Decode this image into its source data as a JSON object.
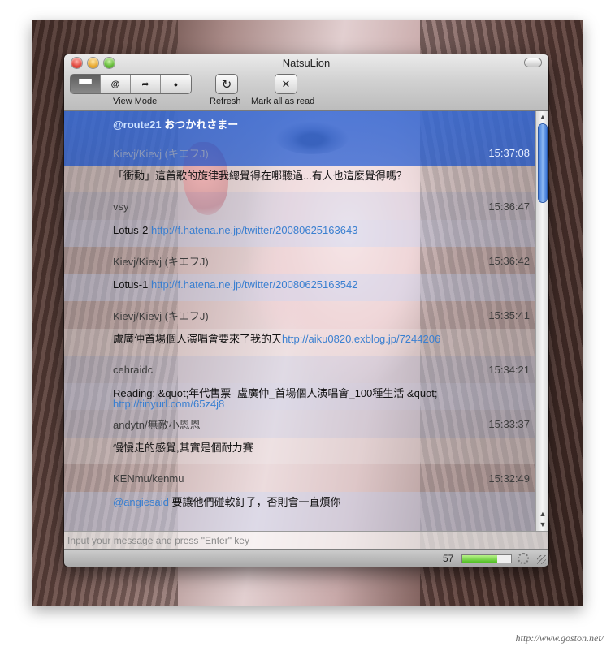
{
  "window": {
    "title": "NatsuLion"
  },
  "toolbar": {
    "view_mode_label": "View Mode",
    "view_mode_buttons": [
      {
        "icon": "people-icon",
        "glyph": "▀▀"
      },
      {
        "icon": "at-icon",
        "glyph": "@"
      },
      {
        "icon": "forward-icon",
        "glyph": "➦"
      },
      {
        "icon": "dot-icon",
        "glyph": "●"
      }
    ],
    "refresh_label": "Refresh",
    "refresh_glyph": "↻",
    "mark_read_label": "Mark all as read",
    "mark_read_glyph": "✕"
  },
  "timeline": {
    "selected_message": {
      "mention": "@route21",
      "text": " おつかれさまー"
    },
    "entries": [
      {
        "author": "Kievj/Kievj (キエフJ)",
        "time": "15:37:08",
        "prefix": "",
        "text": "「衝動」這首歌的旋律我總覺得在哪聽過...有人也這麼覺得嗎？",
        "link": ""
      },
      {
        "author": "vsy",
        "time": "15:36:47",
        "prefix": "",
        "text": "Lotus-2 ",
        "link": "http://f.hatena.ne.jp/twitter/20080625163643"
      },
      {
        "author": "Kievj/Kievj (キエフJ)",
        "time": "15:36:42",
        "prefix": "",
        "text": "Lotus-1 ",
        "link": "http://f.hatena.ne.jp/twitter/20080625163542"
      },
      {
        "author": "Kievj/Kievj (キエフJ)",
        "time": "15:35:41",
        "prefix": "",
        "text": "盧廣仲首場個人演唱會要來了我的天",
        "link": "http://aiku0820.exblog.jp/7244206"
      },
      {
        "author": "cehraidc",
        "time": "15:34:21",
        "prefix": "",
        "text": "Reading: &quot;年代售票- 盧廣仲_首場個人演唱會_100種生活 &quot;  ",
        "link": "http://tinyurl.com/65z4j8"
      },
      {
        "author": "andytn/無敵小恩恩",
        "time": "15:33:37",
        "prefix": "",
        "text": "慢慢走的感覺,其實是個耐力賽",
        "link": ""
      },
      {
        "author": "KENmu/kenmu",
        "time": "15:32:49",
        "prefix": "@angiesaid",
        "text": " 要讓他們碰軟釘子，否則會一直煩你",
        "link": ""
      }
    ]
  },
  "input": {
    "placeholder": "Input your message and press \"Enter\" key",
    "value": ""
  },
  "status": {
    "unread_count": "57",
    "meter_fraction": 0.72
  },
  "watermark": "http://www.goston.net/",
  "colors": {
    "selection": "#3c6ed7",
    "link": "#3a7fd0",
    "scroll_thumb": "#3b77d8"
  }
}
